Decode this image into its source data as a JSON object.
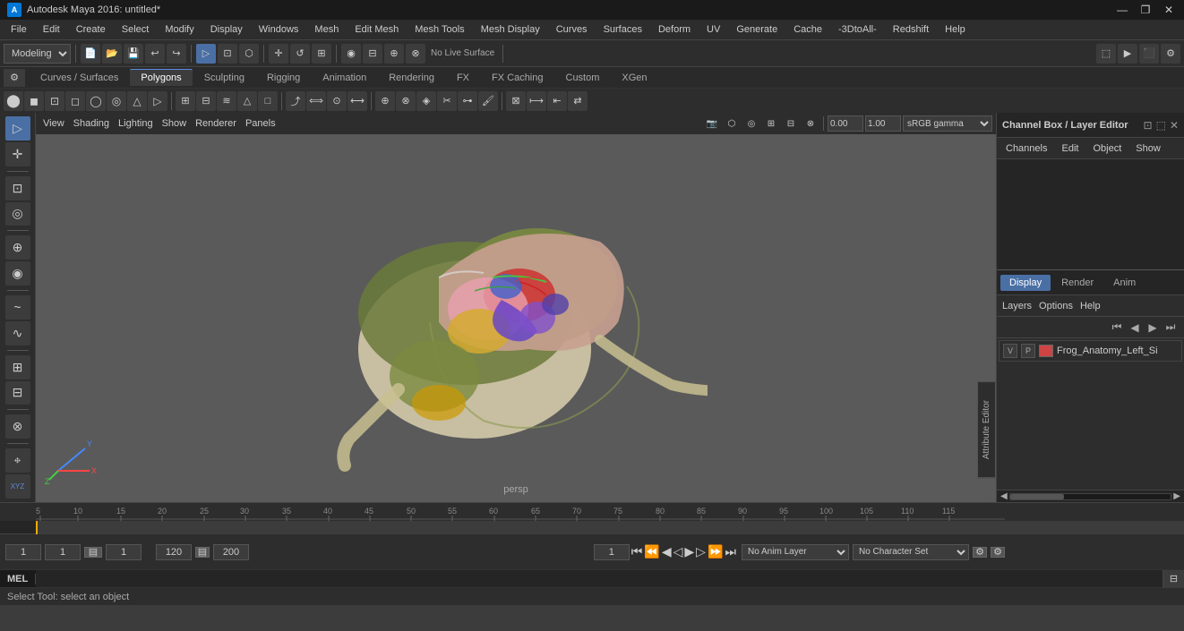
{
  "titleBar": {
    "icon": "A",
    "title": "Autodesk Maya 2016: untitled*",
    "controls": [
      "—",
      "❐",
      "✕"
    ]
  },
  "menuBar": {
    "items": [
      "File",
      "Edit",
      "Create",
      "Select",
      "Modify",
      "Display",
      "Windows",
      "Mesh",
      "Edit Mesh",
      "Mesh Tools",
      "Mesh Display",
      "Curves",
      "Surfaces",
      "Deform",
      "UV",
      "Generate",
      "Cache",
      "-3DtoAll-",
      "Redshift",
      "Help"
    ]
  },
  "toolbar1": {
    "dropdown": "Modeling",
    "buttons": [
      "📁",
      "💾",
      "✂",
      "↩",
      "↪",
      "⬡",
      "⬡",
      "→",
      "↗",
      "↘",
      "⊕",
      "⊕"
    ]
  },
  "tabs": {
    "items": [
      "Curves / Surfaces",
      "Polygons",
      "Sculpting",
      "Rigging",
      "Animation",
      "Rendering",
      "FX",
      "FX Caching",
      "Custom",
      "XGen"
    ],
    "active": "Polygons"
  },
  "viewport": {
    "label": "persp",
    "menuItems": [
      "View",
      "Shading",
      "Lighting",
      "Show",
      "Renderer",
      "Panels"
    ],
    "colorSpace": "sRGB gamma",
    "xValue": "0.00",
    "yValue": "1.00"
  },
  "channelBox": {
    "title": "Channel Box / Layer Editor",
    "navItems": [
      "Channels",
      "Edit",
      "Object",
      "Show"
    ]
  },
  "rightBottom": {
    "tabs": [
      "Display",
      "Render",
      "Anim"
    ],
    "activeTab": "Display",
    "menuItems": [
      "Layers",
      "Options",
      "Help"
    ],
    "layers": [
      {
        "v": "V",
        "p": "P",
        "color": "#cc4444",
        "name": "Frog_Anatomy_Left_Si"
      }
    ]
  },
  "timeline": {
    "ticks": [
      5,
      10,
      15,
      20,
      25,
      30,
      35,
      40,
      45,
      50,
      55,
      60,
      65,
      70,
      75,
      80,
      85,
      90,
      95,
      100,
      105,
      110,
      115
    ],
    "startFrame": "1",
    "endFrame": "120",
    "currentFrame": "1",
    "playbackEnd": "120",
    "rangeEnd": "200"
  },
  "statusBar": {
    "frame1": "1",
    "frame2": "1",
    "frameDisplay": "1",
    "endFrame": "120",
    "rangeEnd": "200",
    "animLayer": "No Anim Layer",
    "charSet": "No Character Set"
  },
  "commandLine": {
    "label": "MEL",
    "placeholder": ""
  },
  "bottomStatus": {
    "text": "Select Tool: select an object"
  },
  "attributeEditor": {
    "label": "Attribute Editor"
  }
}
